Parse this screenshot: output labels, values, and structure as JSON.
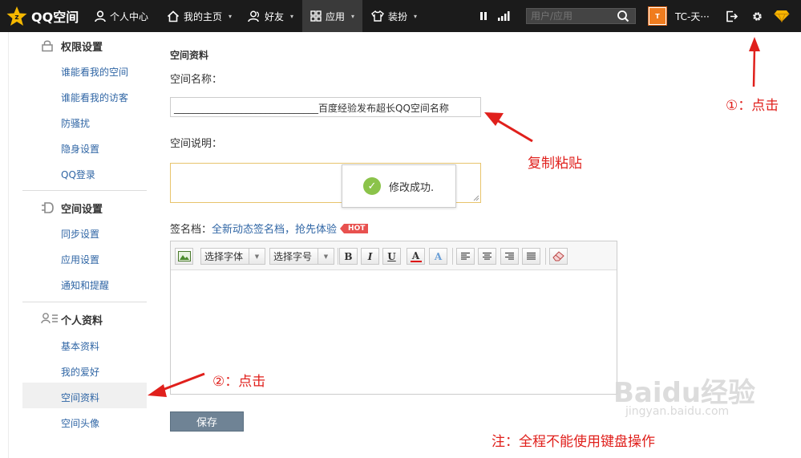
{
  "topbar": {
    "logo_text": "QQ空间",
    "nav": [
      {
        "label": "个人中心",
        "icon": "person-icon"
      },
      {
        "label": "我的主页",
        "icon": "home-icon"
      },
      {
        "label": "好友",
        "icon": "friends-icon"
      },
      {
        "label": "应用",
        "icon": "grid-icon"
      },
      {
        "label": "装扮",
        "icon": "tshirt-icon"
      }
    ],
    "search_placeholder": "用户/应用",
    "avatar_text": "T",
    "username": "TC-天···"
  },
  "sidebar": {
    "sections": [
      {
        "title": "权限设置",
        "icon": "lock-icon",
        "items": [
          "谁能看我的空间",
          "谁能看我的访客",
          "防骚扰",
          "隐身设置",
          "QQ登录"
        ]
      },
      {
        "title": "空间设置",
        "icon": "plug-icon",
        "items": [
          "同步设置",
          "应用设置",
          "通知和提醒"
        ]
      },
      {
        "title": "个人资料",
        "icon": "profile-icon",
        "items": [
          "基本资料",
          "我的爱好",
          "空间资料",
          "空间头像"
        ]
      }
    ],
    "selected": "空间资料"
  },
  "main": {
    "section_title": "空间资料",
    "name_label": "空间名称：",
    "name_value": "______________________________百度经验发布超长QQ空间名称",
    "desc_label": "空间说明：",
    "toast": "修改成功.",
    "signature_label": "签名档：",
    "signature_link": "全新动态签名档，抢先体验",
    "hot_badge": "HOT",
    "font_select": "选择字体",
    "size_select": "选择字号",
    "save_label": "保存"
  },
  "annotations": {
    "step1": "①：点击",
    "paste": "复制粘贴",
    "step2": "②：点击",
    "note": "注：全程不能使用键盘操作"
  },
  "watermark": {
    "main": "Baidu经验",
    "sub": "jingyan.baidu.com"
  },
  "colors": {
    "topbar": "#1b1b1b",
    "link": "#3066a5",
    "annotation": "#e0201c",
    "save_button": "#6f8395"
  }
}
